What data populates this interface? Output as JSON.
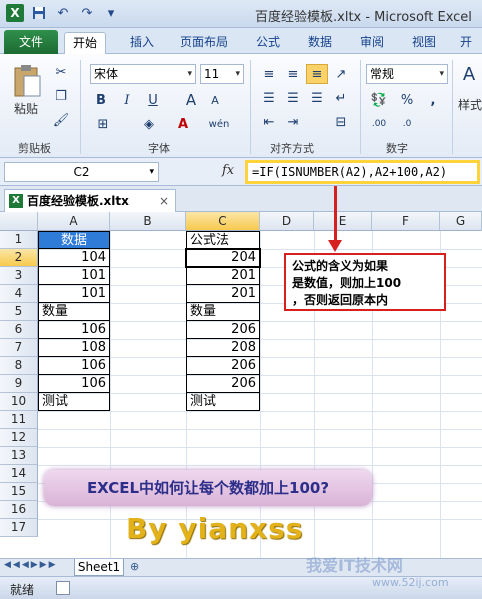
{
  "window": {
    "title": "百度经验模板.xltx - Microsoft Excel"
  },
  "ribbon_tabs": [
    "文件",
    "开始",
    "插入",
    "页面布局",
    "公式",
    "数据",
    "审阅",
    "视图",
    "开发"
  ],
  "ribbon": {
    "paste_label": "粘贴",
    "clipboard_label": "剪贴板",
    "font_name": "宋体",
    "font_size": "11",
    "font_label": "字体",
    "bold": "B",
    "italic": "I",
    "underline": "U",
    "grow": "A",
    "shrink": "A",
    "wen": "wén",
    "align_label": "对齐方式",
    "number_format": "常规",
    "number_label": "数字",
    "style_label": "样式"
  },
  "formula_bar": {
    "name_box": "C2",
    "fx": "fx",
    "formula": "=IF(ISNUMBER(A2),A2+100,A2)"
  },
  "workbook_tab": {
    "name": "百度经验模板.xltx"
  },
  "columns": [
    "A",
    "B",
    "C",
    "D",
    "E",
    "F",
    "G"
  ],
  "rows": [
    "1",
    "2",
    "3",
    "4",
    "5",
    "6",
    "7",
    "8",
    "9",
    "10",
    "11",
    "12",
    "13",
    "14",
    "15",
    "16",
    "17"
  ],
  "cells": {
    "A1": "数据",
    "A2": "104",
    "A3": "101",
    "A4": "101",
    "A5": "数量",
    "A6": "106",
    "A7": "108",
    "A8": "106",
    "A9": "106",
    "A10": "测试",
    "C1": "公式法",
    "C2": "204",
    "C3": "201",
    "C4": "201",
    "C5": "数量",
    "C6": "206",
    "C7": "208",
    "C8": "206",
    "C9": "206",
    "C10": "测试"
  },
  "annotation": {
    "line1": "公式的含义为如果",
    "line2": "是数值，则加上100",
    "line3": "，否则返回原本内"
  },
  "banner": "EXCEL中如何让每个数都加上100?",
  "byline": "By  yianxss",
  "sheet_tab": "Sheet1",
  "status": {
    "ready": "就绪"
  },
  "watermark": {
    "main": "我爱IT技术网",
    "url": "www.52ij.com"
  },
  "colors": {
    "header_fill": "#2f7bd8",
    "highlight": "#ffd33c",
    "arrow": "#d62020",
    "file_tab": "#1d6b33"
  }
}
